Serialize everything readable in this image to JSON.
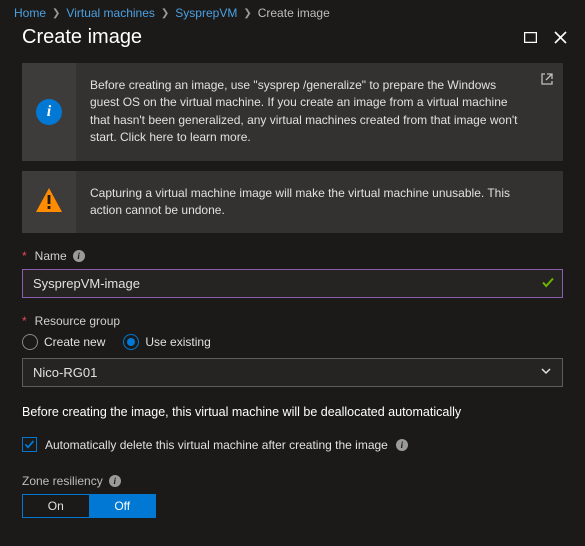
{
  "breadcrumb": {
    "items": [
      "Home",
      "Virtual machines",
      "SysprepVM",
      "Create image"
    ]
  },
  "header": {
    "title": "Create image"
  },
  "alerts": {
    "info": "Before creating an image, use \"sysprep /generalize\" to prepare the Windows guest OS on the virtual machine. If you create an image from a virtual machine that hasn't been generalized, any virtual machines created from that image won't start. Click here to learn more.",
    "warn": "Capturing a virtual machine image will make the virtual machine unusable. This action cannot be undone."
  },
  "fields": {
    "name": {
      "label": "Name",
      "value": "SysprepVM-image"
    },
    "rg": {
      "label": "Resource group",
      "create_label": "Create new",
      "existing_label": "Use existing",
      "selected_value": "Nico-RG01"
    }
  },
  "notes": {
    "deallocate": "Before creating the image, this virtual machine will be deallocated automatically",
    "auto_delete": "Automatically delete this virtual machine after creating the image"
  },
  "zone": {
    "label": "Zone resiliency",
    "on": "On",
    "off": "Off"
  }
}
